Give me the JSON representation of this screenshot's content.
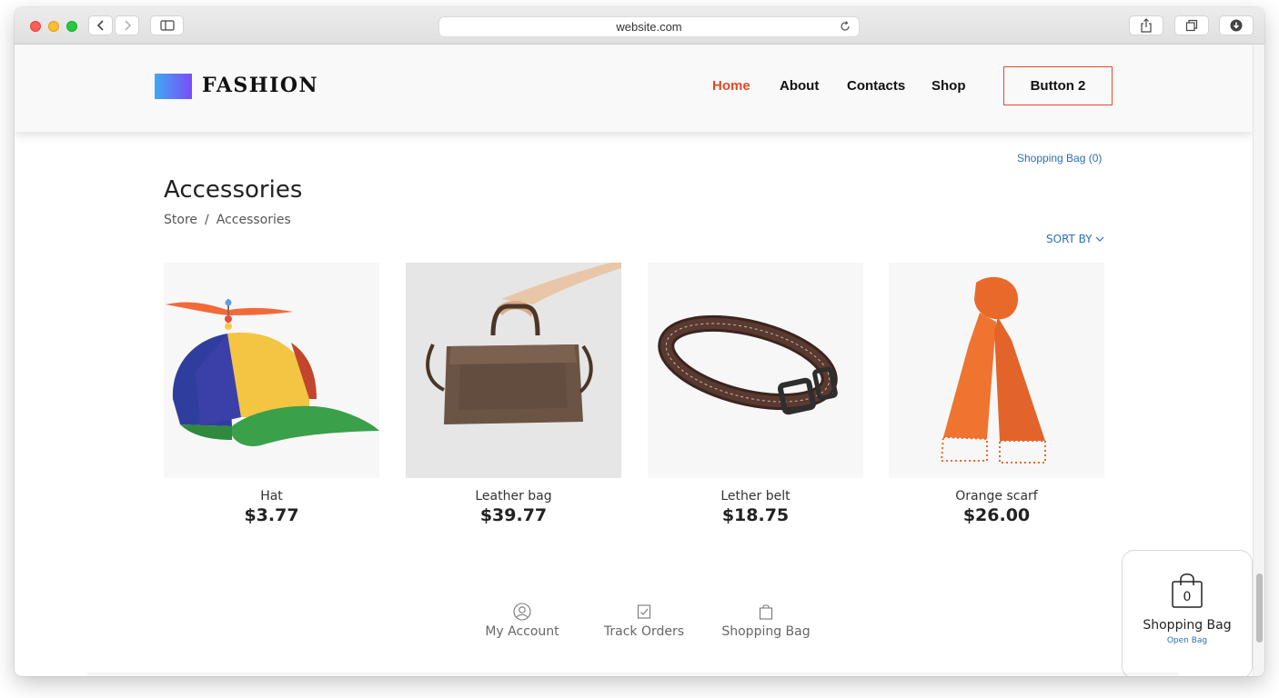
{
  "browser": {
    "url": "website.com",
    "icons": [
      "back-icon",
      "forward-icon",
      "sidebar-icon",
      "reload-icon",
      "share-icon",
      "tabs-icon",
      "download-icon"
    ]
  },
  "header": {
    "logo_text": "FASHION",
    "nav": [
      "Home",
      "About",
      "Contacts",
      "Shop"
    ],
    "active_nav": "Home",
    "button_label": "Button 2",
    "accent_color": "#e34a2b",
    "link_color": "#2c6fb3"
  },
  "shopping_bag_link": "Shopping Bag (0)",
  "page": {
    "title": "Accessories",
    "breadcrumb": [
      "Store",
      "/",
      "Accessories"
    ],
    "sort_label": "SORT BY"
  },
  "products": [
    {
      "name": "Hat",
      "price": "$3.77"
    },
    {
      "name": "Leather bag",
      "price": "$39.77"
    },
    {
      "name": "Lether belt",
      "price": "$18.75"
    },
    {
      "name": "Orange scarf",
      "price": "$26.00"
    }
  ],
  "footer": {
    "links": [
      "My Account",
      "Track Orders",
      "Shopping Bag"
    ]
  },
  "bag_widget": {
    "count": "0",
    "title": "Shopping Bag",
    "action": "Open Bag"
  }
}
